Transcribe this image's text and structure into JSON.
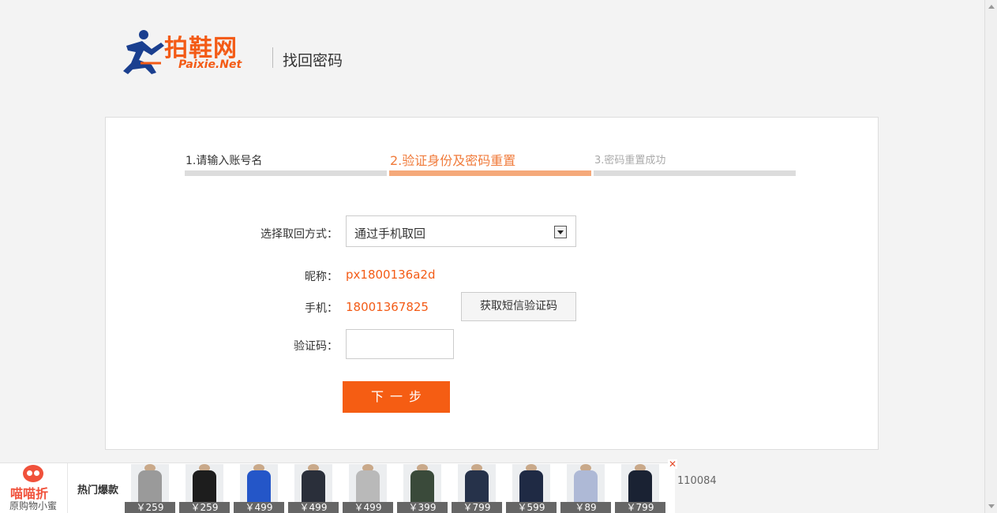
{
  "header": {
    "logo_text": "拍鞋网",
    "logo_sub": "Paixie.Net",
    "title": "找回密码"
  },
  "steps": [
    {
      "label": "1.请输入账号名",
      "state": "done"
    },
    {
      "label": "2.验证身份及密码重置",
      "state": "active"
    },
    {
      "label": "3.密码重置成功",
      "state": "pending"
    }
  ],
  "form": {
    "method_label": "选择取回方式：",
    "method_value": "通过手机取回",
    "nickname_label": "昵称：",
    "nickname_value": "px1800136a2d",
    "phone_label": "手机：",
    "phone_value": "18001367825",
    "sms_button": "获取短信验证码",
    "code_label": "验证码：",
    "code_value": "",
    "next_button": "下一步"
  },
  "footer": {
    "partial_text": "110084"
  },
  "adbar": {
    "brand_name": "喵喵折",
    "brand_slogan": "原购物小蜜",
    "hot_label": "热门爆款",
    "close_glyph": "✕",
    "products": [
      {
        "price": "￥259",
        "color": "#9a9a9a"
      },
      {
        "price": "￥259",
        "color": "#1d1d1d"
      },
      {
        "price": "￥499",
        "color": "#2456c8"
      },
      {
        "price": "￥499",
        "color": "#2a2f3a"
      },
      {
        "price": "￥499",
        "color": "#b9b9b9"
      },
      {
        "price": "￥399",
        "color": "#3a4a3a"
      },
      {
        "price": "￥799",
        "color": "#26324a"
      },
      {
        "price": "￥599",
        "color": "#1f2a44"
      },
      {
        "price": "￥89",
        "color": "#aeb9d6"
      },
      {
        "price": "￥799",
        "color": "#1a2233"
      }
    ]
  },
  "colors": {
    "accent": "#f55d13",
    "active_step": "#f07b3b",
    "active_bar": "#f5a97a",
    "inactive_bar": "#dcdcdc"
  }
}
